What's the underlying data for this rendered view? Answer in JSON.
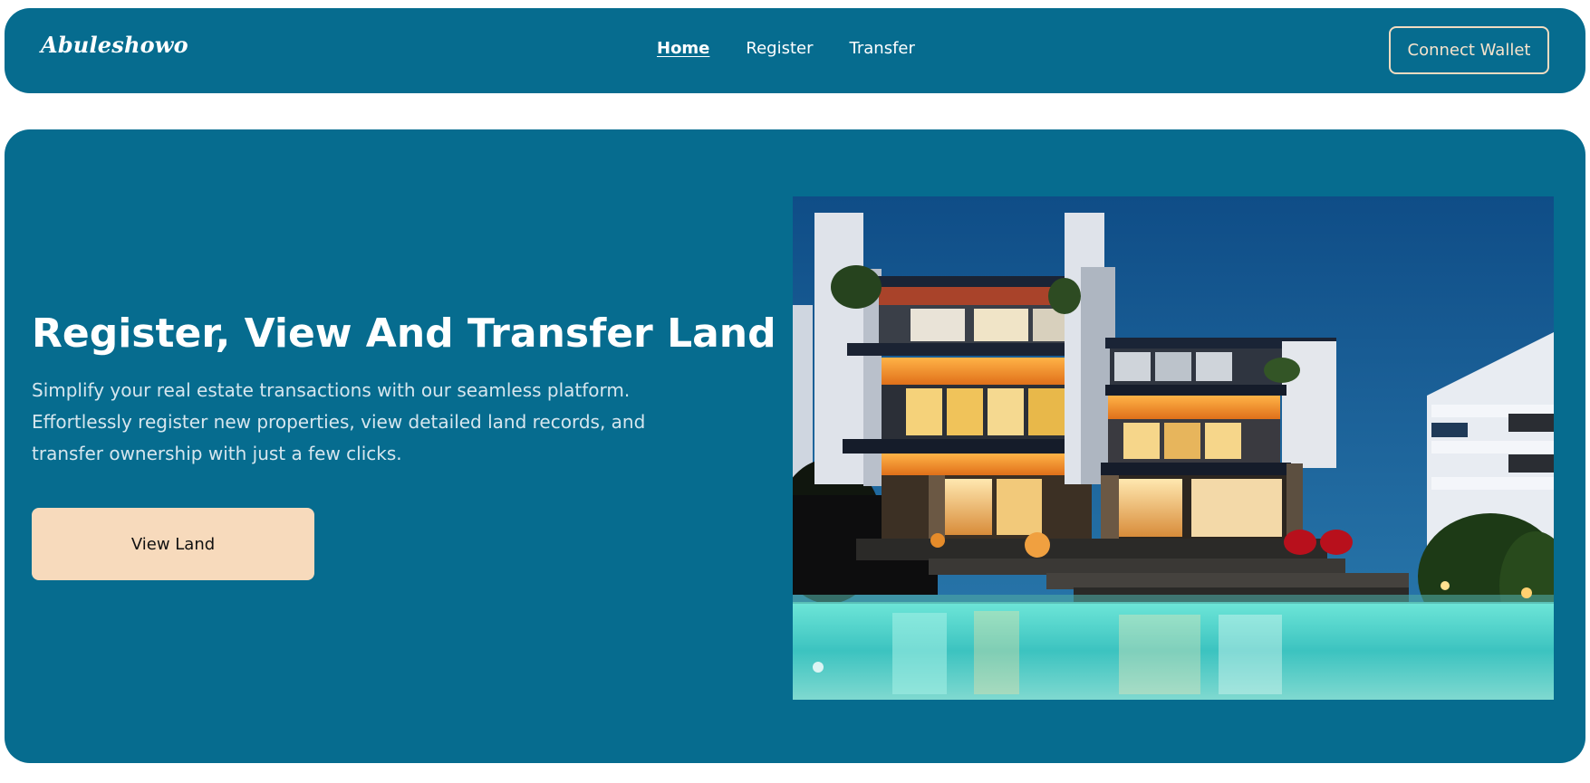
{
  "nav": {
    "logo": "Abuleshowo",
    "links": [
      "Home",
      "Register",
      "Transfer"
    ],
    "active": "Home",
    "connect_wallet": "Connect Wallet"
  },
  "hero": {
    "title": "Register, View And Transfer Land",
    "description": "Simplify your real estate transactions with our seamless platform. Effortlessly register new properties, view detailed land records, and transfer ownership with just a few clicks.",
    "cta": "View Land",
    "image": "modern-villa-with-pool-photo"
  },
  "colors": {
    "primary": "#066c8f",
    "accent": "#f7dabc",
    "text": "#ffffff"
  }
}
